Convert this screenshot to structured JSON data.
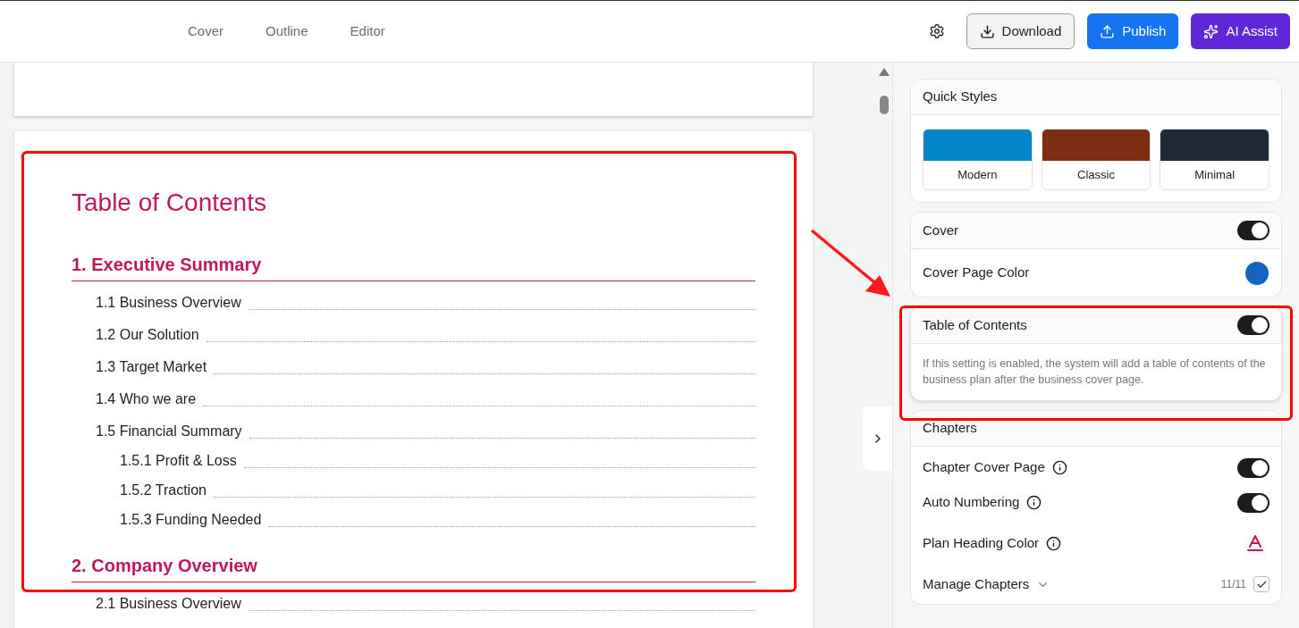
{
  "nav_tabs": [
    {
      "label": "Cover",
      "selected": false
    },
    {
      "label": "Outline",
      "selected": false
    },
    {
      "label": "Editor",
      "selected": false
    }
  ],
  "header_buttons": [
    {
      "kind": "download",
      "label": "Download"
    },
    {
      "kind": "publish",
      "label": "Publish"
    },
    {
      "kind": "ai",
      "label": "AI Assist"
    }
  ],
  "document": {
    "title": "Table of Contents",
    "chapters": [
      {
        "label": "1. Executive Summary",
        "children": [
          {
            "label": "1.1 Business Overview"
          },
          {
            "label": "1.2 Our Solution"
          },
          {
            "label": "1.3 Target Market"
          },
          {
            "label": "1.4 Who we are"
          },
          {
            "label": "1.5 Financial Summary",
            "children": [
              {
                "label": "1.5.1 Profit & Loss"
              },
              {
                "label": "1.5.2 Traction"
              },
              {
                "label": "1.5.3 Funding Needed"
              }
            ]
          }
        ]
      },
      {
        "label": "2. Company Overview",
        "children": [
          {
            "label": "2.1 Business Overview"
          }
        ]
      }
    ]
  },
  "quick_styles": {
    "title": "Quick Styles",
    "styles": [
      {
        "label": "Modern",
        "color": "#0284c7"
      },
      {
        "label": "Classic",
        "color": "#7c2d12"
      },
      {
        "label": "Minimal",
        "color": "#1f2937"
      }
    ]
  },
  "cover": {
    "label": "Cover",
    "on": true,
    "color_label": "Cover Page Color",
    "color": "#1565c0"
  },
  "toc_setting": {
    "label": "Table of Contents",
    "on": true,
    "description": "If this setting is enabled, the system will add a table of contents of the business plan after the business cover page."
  },
  "chapters": {
    "title": "Chapters",
    "rows": [
      {
        "kind": "toggle",
        "label": "Chapter Cover Page",
        "on": true
      },
      {
        "kind": "toggle",
        "label": "Auto Numbering",
        "on": true
      },
      {
        "kind": "color",
        "label": "Plan Heading Color",
        "color": "#c2185b"
      },
      {
        "kind": "manage",
        "label": "Manage Chapters",
        "count": "11/11",
        "checked": true
      }
    ]
  }
}
